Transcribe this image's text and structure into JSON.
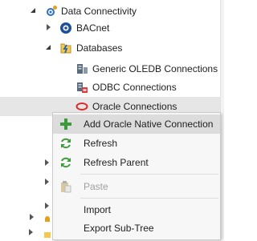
{
  "tree": {
    "data_connectivity": {
      "label": "Data Connectivity",
      "icon": "gear-connectivity-icon"
    },
    "bacnet": {
      "label": "BACnet",
      "icon": "bacnet-icon"
    },
    "databases": {
      "label": "Databases",
      "icon": "database-folder-icon"
    },
    "generic_oledb": {
      "label": "Generic OLEDB Connections",
      "icon": "oledb-icon"
    },
    "odbc": {
      "label": "ODBC Connections",
      "icon": "odbc-icon"
    },
    "oracle": {
      "label": "Oracle Connections",
      "icon": "oracle-icon"
    }
  },
  "context_menu": {
    "add_native": {
      "label": "Add Oracle Native Connection",
      "icon": "plus-icon",
      "enabled": true
    },
    "refresh": {
      "label": "Refresh",
      "icon": "refresh-icon",
      "enabled": true
    },
    "refresh_parent": {
      "label": "Refresh Parent",
      "icon": "refresh-icon",
      "enabled": true
    },
    "paste": {
      "label": "Paste",
      "icon": "paste-icon",
      "enabled": false
    },
    "import": {
      "label": "Import",
      "icon": "import-icon",
      "enabled": true
    },
    "export_subtree": {
      "label": "Export Sub-Tree",
      "icon": "export-icon",
      "enabled": true
    }
  },
  "colors": {
    "accent_green": "#3c9a3c",
    "oracle_red": "#d92b2b",
    "icon_blue": "#1f5fa8",
    "selection_gray": "#e6e6e6"
  }
}
